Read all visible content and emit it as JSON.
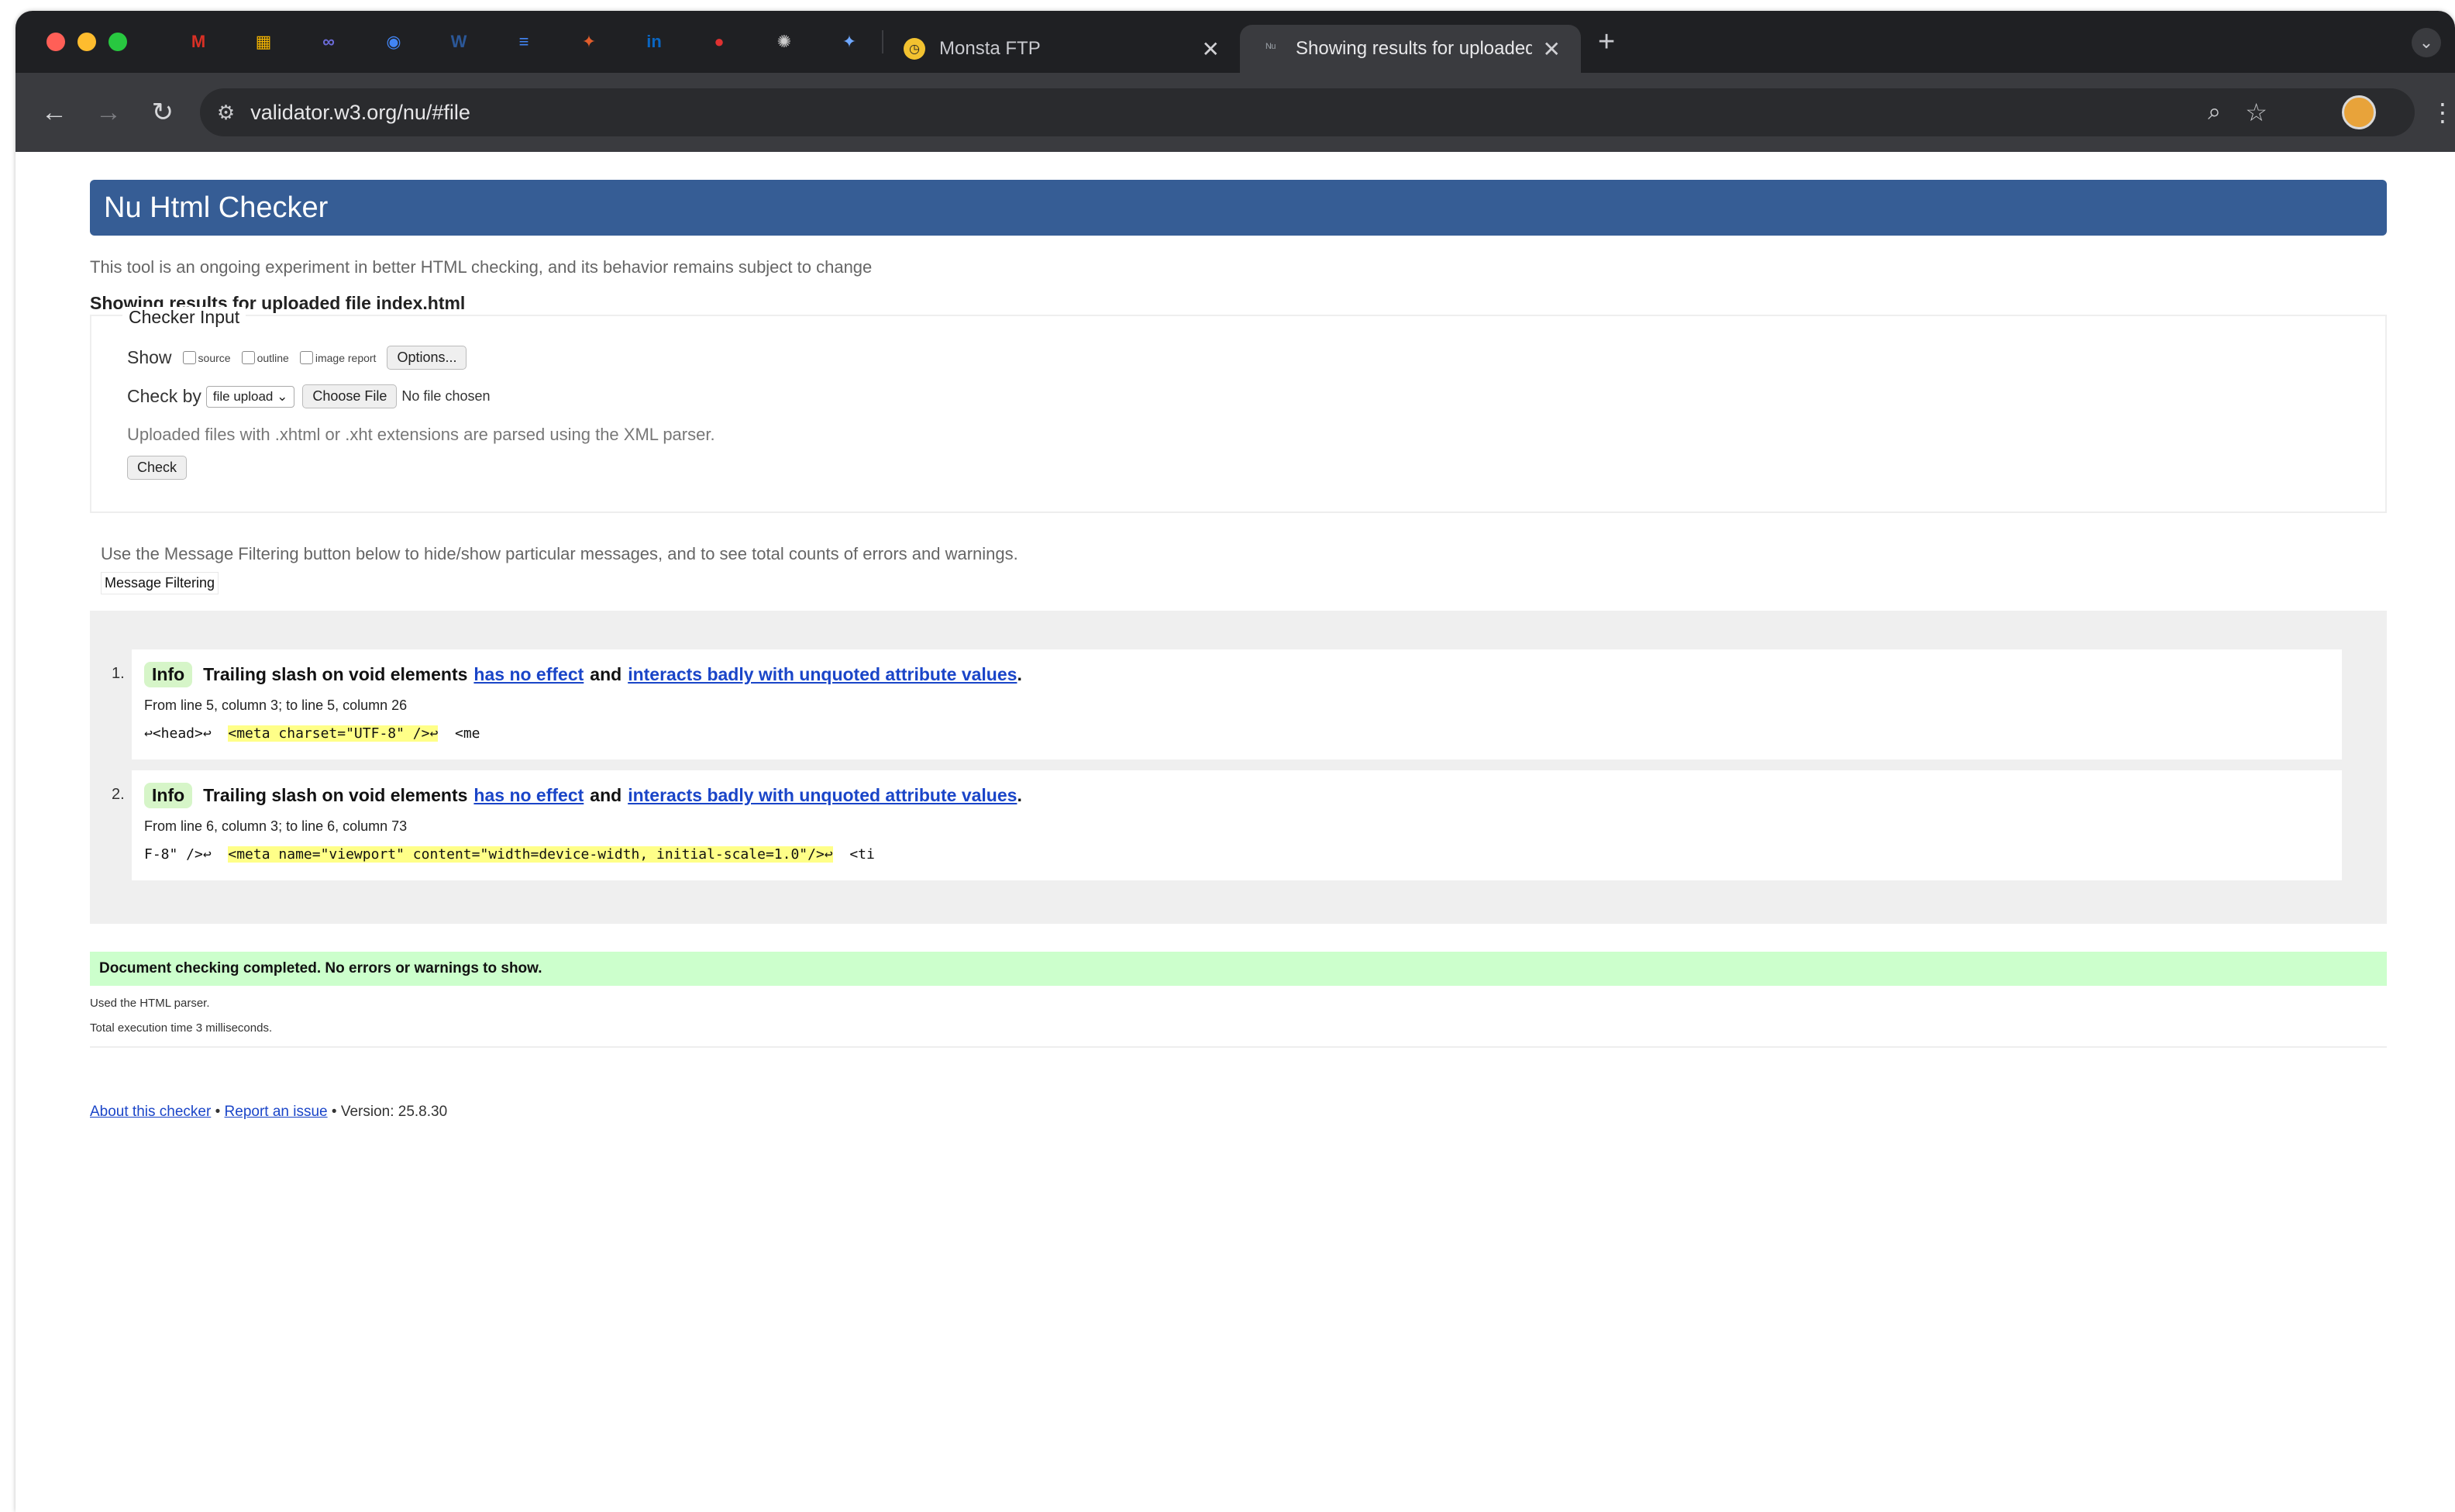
{
  "browser": {
    "pinned_tabs": [
      {
        "icon": "gmail-icon",
        "glyph": "M",
        "color": "#d93025"
      },
      {
        "icon": "photos-icon",
        "glyph": "▦",
        "color": "#f4b400"
      },
      {
        "icon": "infinity-icon",
        "glyph": "∞",
        "color": "#6b6bd8"
      },
      {
        "icon": "chrome-icon",
        "glyph": "◉",
        "color": "#4285f4"
      },
      {
        "icon": "word-icon",
        "glyph": "W",
        "color": "#2b5797"
      },
      {
        "icon": "docs-icon",
        "glyph": "≡",
        "color": "#4285f4"
      },
      {
        "icon": "app-icon",
        "glyph": "✦",
        "color": "#e05d2c"
      },
      {
        "icon": "linkedin-icon",
        "glyph": "in",
        "color": "#0a66c2"
      },
      {
        "icon": "record-icon",
        "glyph": "●",
        "color": "#e03131"
      },
      {
        "icon": "openai-icon",
        "glyph": "✺",
        "color": "#cccccc"
      },
      {
        "icon": "gemini-icon",
        "glyph": "✦",
        "color": "#6fa8ff"
      }
    ],
    "tabs": [
      {
        "title": "Monsta FTP",
        "icon": "monsta-ftp-icon",
        "state": "inactive"
      },
      {
        "title": "Showing results for uploaded",
        "icon": "nu-checker-icon",
        "state": "active"
      }
    ],
    "url": "validator.w3.org/nu/#file"
  },
  "page": {
    "header_title": "Nu Html Checker",
    "tagline": "This tool is an ongoing experiment in better HTML checking, and its behavior remains subject to change",
    "results_for": "Showing results for uploaded file index.html",
    "checker_input": {
      "legend": "Checker Input",
      "show_label": "Show",
      "options": [
        "source",
        "outline",
        "image report"
      ],
      "options_button": "Options...",
      "check_by_label": "Check by",
      "check_by_value": "file upload",
      "choose_file_button": "Choose File",
      "no_file_text": "No file chosen",
      "xml_hint": "Uploaded files with .xhtml or .xht extensions are parsed using the XML parser.",
      "check_button": "Check"
    },
    "filter_note": "Use the Message Filtering button below to hide/show particular messages, and to see total counts of errors and warnings.",
    "filter_button": "Message Filtering",
    "messages": [
      {
        "num": "1.",
        "type": "Info",
        "text_before": "Trailing slash on void elements",
        "link1": "has no effect",
        "text_mid": "and",
        "link2": "interacts badly with unquoted attribute values",
        "text_end": ".",
        "location": "From line 5, column 3; to line 5, column 26",
        "code_before": "↩<head>↩  ",
        "code_highlight": "<meta charset=\"UTF-8\" />↩",
        "code_after": "  <me"
      },
      {
        "num": "2.",
        "type": "Info",
        "text_before": "Trailing slash on void elements",
        "link1": "has no effect",
        "text_mid": "and",
        "link2": "interacts badly with unquoted attribute values",
        "text_end": ".",
        "location": "From line 6, column 3; to line 6, column 73",
        "code_before": "F-8\" />↩  ",
        "code_highlight": "<meta name=\"viewport\" content=\"width=device-width, initial-scale=1.0\"/>↩",
        "code_after": "  <ti"
      }
    ],
    "success": "Document checking completed. No errors or warnings to show.",
    "parser_note": "Used the HTML parser.",
    "exec_time": "Total execution time 3 milliseconds.",
    "footer": {
      "about": "About this checker",
      "sep1": "•",
      "report": "Report an issue",
      "sep2": "•",
      "version": "Version: 25.8.30"
    }
  }
}
